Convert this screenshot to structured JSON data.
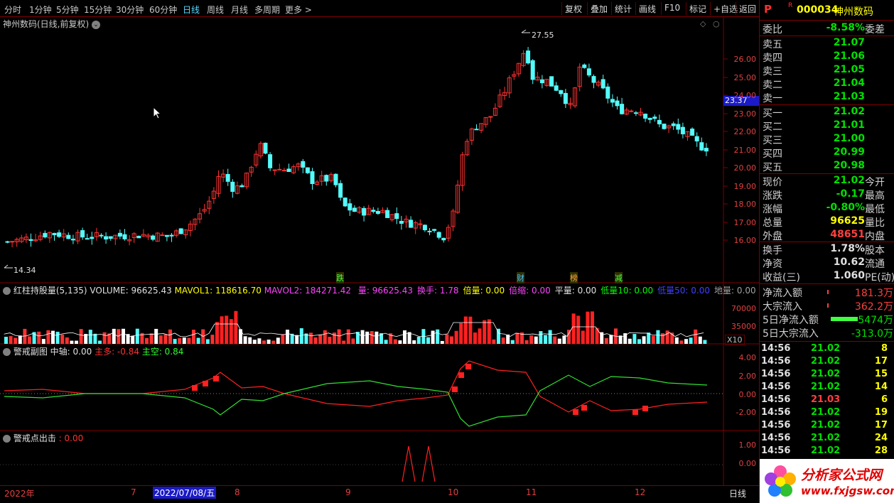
{
  "toolbar": {
    "periods": [
      "分时",
      "1分钟",
      "5分钟",
      "15分钟",
      "30分钟",
      "60分钟",
      "日线",
      "周线",
      "月线",
      "多周期",
      "更多 >"
    ],
    "buttons": [
      "复权",
      "叠加",
      "统计",
      "画线",
      "F10",
      "标记",
      "+自选",
      "返回"
    ]
  },
  "main_chart": {
    "title": "神州数码(日线,前复权)",
    "high_label": "27.55",
    "low_label": "14.34",
    "price_tag": "23.37",
    "y_ticks": [
      "26.00",
      "25.00",
      "24.00",
      "23.00",
      "22.00",
      "21.00",
      "20.00",
      "19.00",
      "18.00",
      "17.00",
      "16.00"
    ],
    "event_markers": [
      "跌",
      "财",
      "榜",
      "减"
    ],
    "colors": {
      "up": "#ff3232",
      "down": "#54fcfc",
      "bg": "#000000",
      "grid": "#800000"
    }
  },
  "volume_pane": {
    "name": "红柱持股量(5,135)",
    "volume": "VOLUME: 96625.43",
    "mavol1": "MAVOL1: 118616.70",
    "mavol2": "MAVOL2: 184271.42",
    "extra": [
      {
        "label": "量: 96625.43",
        "color": "#ff44ff"
      },
      {
        "label": "换手: 1.78",
        "color": "#ff44ff"
      },
      {
        "label": "倍量: 0.00",
        "color": "#ffff00"
      },
      {
        "label": "倍缩: 0.00",
        "color": "#ff44ff"
      },
      {
        "label": "平量: 0.00",
        "color": "#e0e0e0"
      },
      {
        "label": "低量10: 0.00",
        "color": "#00ff00"
      },
      {
        "label": "低量50: 0.00",
        "color": "#4040ff"
      },
      {
        "label": "地量: 0.00",
        "color": "#a0a0a0"
      }
    ],
    "y_ticks": [
      "70000",
      "35000"
    ],
    "unit": "X10"
  },
  "sub_pane": {
    "name": "警戒副图",
    "mid": "中轴: 0.00",
    "main_long": "主多: -0.84",
    "main_short": "主空: 0.84",
    "y_ticks": [
      "4.00",
      "2.00",
      "0.00",
      "-2.00"
    ]
  },
  "signal_pane": {
    "name": "警戒点出击",
    "value": ": 0.00",
    "y_ticks": [
      "1.00",
      "0.00"
    ]
  },
  "date_axis": {
    "labels": [
      "2022年",
      "7",
      "2022/07/08/五",
      "8",
      "9",
      "10",
      "11",
      "12"
    ],
    "right_label": "日线"
  },
  "quote": {
    "code": "000034",
    "name": "神州数码",
    "webi": {
      "label": "委比",
      "value": "-8.58%",
      "label2": "委差"
    },
    "sells": [
      {
        "label": "卖五",
        "price": "21.07"
      },
      {
        "label": "卖四",
        "price": "21.06"
      },
      {
        "label": "卖三",
        "price": "21.05"
      },
      {
        "label": "卖二",
        "price": "21.04"
      },
      {
        "label": "卖一",
        "price": "21.03"
      }
    ],
    "buys": [
      {
        "label": "买一",
        "price": "21.02"
      },
      {
        "label": "买二",
        "price": "21.01"
      },
      {
        "label": "买三",
        "price": "21.00"
      },
      {
        "label": "买四",
        "price": "20.99"
      },
      {
        "label": "买五",
        "price": "20.98"
      }
    ],
    "stats": [
      {
        "l": "现价",
        "v": "21.02",
        "c": "#00e000",
        "r": "今开"
      },
      {
        "l": "涨跌",
        "v": "-0.17",
        "c": "#00e000",
        "r": "最高"
      },
      {
        "l": "涨幅",
        "v": "-0.80%",
        "c": "#00e000",
        "r": "最低"
      },
      {
        "l": "总量",
        "v": "96625",
        "c": "#ffff00",
        "r": "量比"
      },
      {
        "l": "外盘",
        "v": "48651",
        "c": "#ff4040",
        "r": "内盘"
      }
    ],
    "stats2": [
      {
        "l": "换手",
        "v": "1.78%",
        "c": "#e0e0e0",
        "r": "股本"
      },
      {
        "l": "净资",
        "v": "10.62",
        "c": "#e0e0e0",
        "r": "流通"
      },
      {
        "l": "收益(三)",
        "v": "1.060",
        "c": "#e0e0e0",
        "r": "PE(动)"
      }
    ],
    "flows": [
      {
        "l": "净流入额",
        "v": "181.3万",
        "c": "#ff4040"
      },
      {
        "l": "大宗流入",
        "v": "362.2万",
        "c": "#ff4040"
      },
      {
        "l": "5日净流入额",
        "v": "-5474万",
        "c": "#00e000"
      },
      {
        "l": "5日大宗流入",
        "v": "-313.0万",
        "c": "#00e000"
      }
    ],
    "ticks": [
      {
        "t": "14:56",
        "p": "21.02",
        "q": "8"
      },
      {
        "t": "14:56",
        "p": "21.02",
        "q": "17"
      },
      {
        "t": "14:56",
        "p": "21.02",
        "q": "15"
      },
      {
        "t": "14:56",
        "p": "21.02",
        "q": "14"
      },
      {
        "t": "14:56",
        "p": "21.03",
        "q": "6"
      },
      {
        "t": "14:56",
        "p": "21.02",
        "q": "19"
      },
      {
        "t": "14:56",
        "p": "21.02",
        "q": "17"
      },
      {
        "t": "14:56",
        "p": "21.02",
        "q": "24"
      },
      {
        "t": "14:56",
        "p": "21.02",
        "q": "28"
      }
    ]
  },
  "watermark": {
    "name": "分析家公式网",
    "url": "www.fxjgsw.com"
  }
}
